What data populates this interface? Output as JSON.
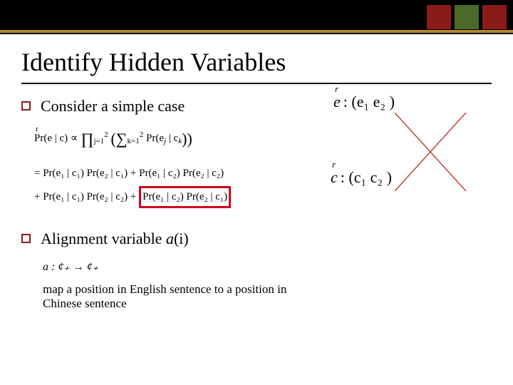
{
  "decor": {
    "colors": {
      "dark_red": "#8b1a1a",
      "olive": "#4a6b2a",
      "gold": "#b08a2a",
      "highlight_red": "#d00020"
    }
  },
  "title": "Identify Hidden Variables",
  "bullets": {
    "b1": "Consider a simple case",
    "b2_prefix": "Alignment variable ",
    "b2_var": "a",
    "b2_arg": "(i)"
  },
  "math": {
    "line1_lhs": "Pr(e | c) ∝ ",
    "line1_prod": "∏",
    "line1_prod_sub": "j=1",
    "line1_prod_sup": "2",
    "line1_lparen": "(",
    "line1_sum": "∑",
    "line1_sum_sub": "k=1",
    "line1_sum_sup": "2",
    "line1_inner": "Pr(e",
    "line1_j": "j",
    "line1_mid": " | c",
    "line1_k": "k",
    "line1_rparen": "))",
    "line2": "= Pr(e₁ | c₁) Pr(e₂ | c₁) + Pr(e₁ | c₂) Pr(e₂ | c₂)",
    "line3_pre": "+ Pr(e₁ | c₁) Pr(e₂ | c₂) + ",
    "line3_box": "Pr(e₁ | c₂) Pr(e₂ | c₁)"
  },
  "alignment_def": {
    "a": "a : ¢₊ → ¢₊",
    "map": "map a position in English sentence to a position in Chinese sentence"
  },
  "vectors": {
    "e_label": "e",
    "e_expr": " : (e₁    e₂ )",
    "c_label": "c",
    "c_expr": " : (c₁    c₂ )"
  }
}
